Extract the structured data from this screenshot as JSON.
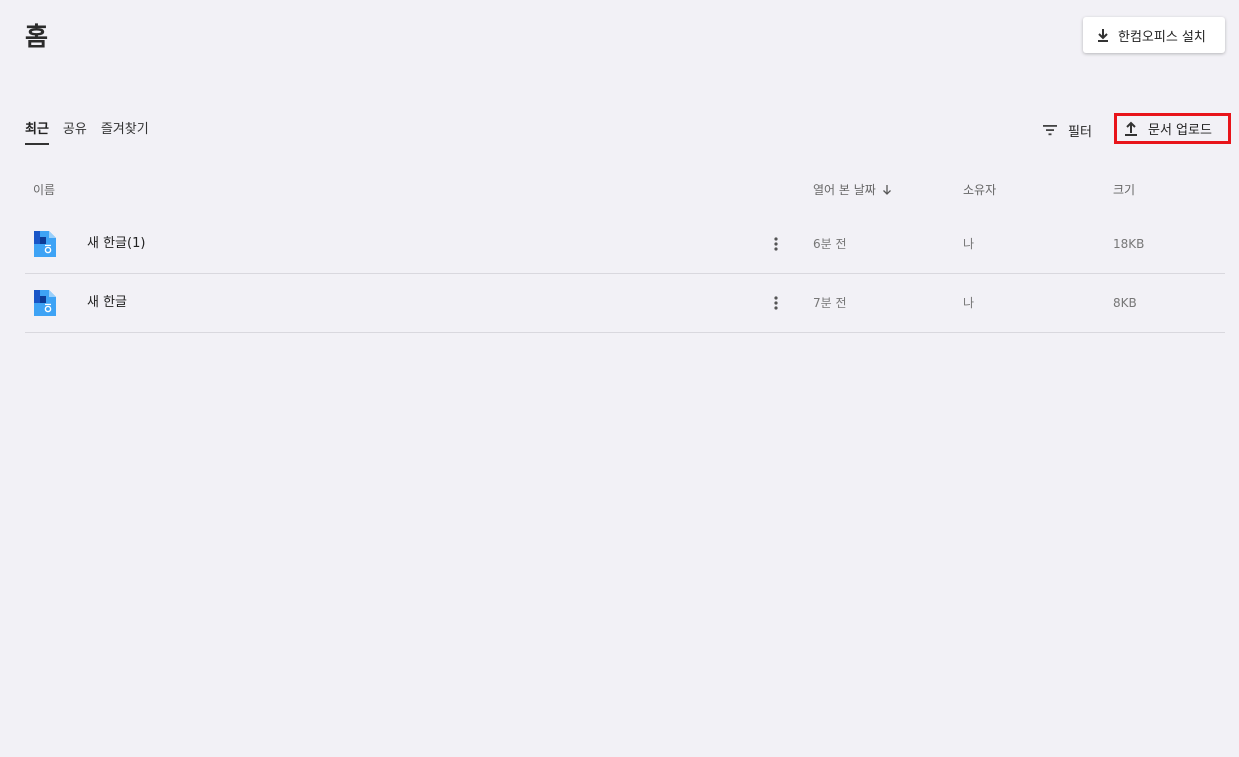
{
  "header": {
    "title": "홈",
    "install_label": "한컴오피스 설치"
  },
  "tabs": [
    {
      "label": "최근",
      "active": true
    },
    {
      "label": "공유",
      "active": false
    },
    {
      "label": "즐겨찾기",
      "active": false
    }
  ],
  "toolbar": {
    "filter_label": "필터",
    "upload_label": "문서 업로드"
  },
  "columns": {
    "name": "이름",
    "opened": "열어 본 날짜",
    "owner": "소유자",
    "size": "크기"
  },
  "files": [
    {
      "name": "새 한글(1)",
      "opened": "6분 전",
      "owner": "나",
      "size": "18KB"
    },
    {
      "name": "새 한글",
      "opened": "7분 전",
      "owner": "나",
      "size": "8KB"
    }
  ],
  "colors": {
    "background": "#f2f1f6",
    "highlight_border": "#e8141a",
    "file_icon_blue": "#3ea3f5",
    "file_icon_dark": "#1a56c7"
  }
}
